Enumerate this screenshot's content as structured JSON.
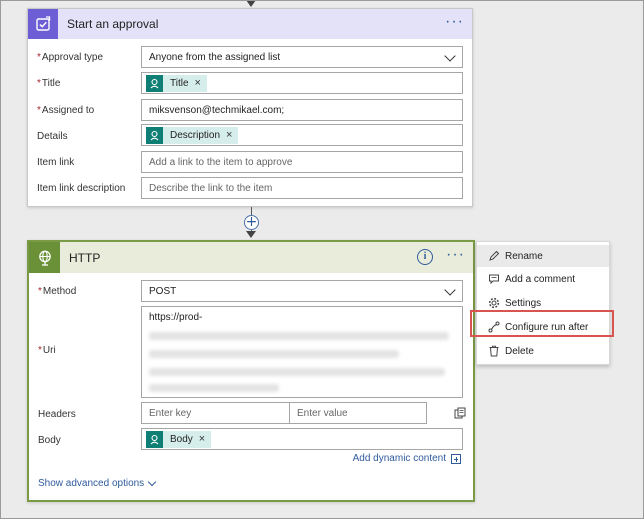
{
  "approval": {
    "title": "Start an approval",
    "approval_type_label": "Approval type",
    "approval_type_value": "Anyone from the assigned list",
    "title_label": "Title",
    "title_token": "Title",
    "assigned_label": "Assigned to",
    "assigned_value": "miksvenson@techmikael.com;",
    "details_label": "Details",
    "details_token": "Description",
    "item_link_label": "Item link",
    "item_link_placeholder": "Add a link to the item to approve",
    "item_link_desc_label": "Item link description",
    "item_link_desc_placeholder": "Describe the link to the item"
  },
  "http": {
    "title": "HTTP",
    "method_label": "Method",
    "method_value": "POST",
    "uri_label": "Uri",
    "uri_value": "https://prod-",
    "headers_label": "Headers",
    "header_key_placeholder": "Enter key",
    "header_value_placeholder": "Enter value",
    "body_label": "Body",
    "body_token": "Body",
    "add_dynamic": "Add dynamic content",
    "show_advanced": "Show advanced options"
  },
  "menu": {
    "items": [
      {
        "label": "Rename",
        "icon": "rename-icon"
      },
      {
        "label": "Add a comment",
        "icon": "comment-icon"
      },
      {
        "label": "Settings",
        "icon": "gear-icon"
      },
      {
        "label": "Configure run after",
        "icon": "run-after-icon"
      },
      {
        "label": "Delete",
        "icon": "trash-icon"
      }
    ]
  },
  "required_mark": "*",
  "ellipsis": "···",
  "close_mark": "×",
  "colors": {
    "approval_accent": "#6e5ed6",
    "http_accent": "#6a9137",
    "token_accent": "#0f7f76",
    "highlight": "#d9534f",
    "link": "#2f5b9c"
  }
}
